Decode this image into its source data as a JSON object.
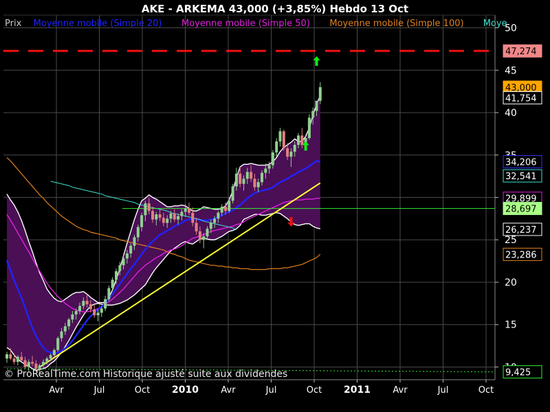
{
  "header": {
    "title": "AKE - ARKEMA    43,000 (+3,85%)    Hebdo  13 Oct"
  },
  "legend": [
    {
      "label": "Prix",
      "color": "#c8c8c8"
    },
    {
      "label": "Moyenne mobile (Simple 20)",
      "color": "#2222ff"
    },
    {
      "label": "Moyenne mobile (Simple 50)",
      "color": "#e020e0"
    },
    {
      "label": "Moyenne mobile (Simple 100)",
      "color": "#e08020"
    },
    {
      "label": "Moye",
      "color": "#40e0d0"
    }
  ],
  "copyright": "© ProRealTime.com Historique ajusté suite aux dividendes",
  "colors": {
    "background": "#000000",
    "band_fill": "#4a0f55",
    "band_edge": "#ffffff",
    "grid": "#4a4a4a",
    "up_candle": "#90d090",
    "down_candle": "#e08080",
    "resistance": "#ee1111",
    "support_line": "#ffff33",
    "horizontal_line": "#33ee33",
    "arrow_up": "#11ee11",
    "arrow_down": "#ee1111"
  },
  "chart_data": {
    "type": "candlestick",
    "ylim": [
      8.5,
      51.5
    ],
    "yticks": [
      10,
      15,
      20,
      25,
      30,
      35,
      40,
      45,
      50
    ],
    "ytick_labels": [
      "10",
      "15",
      "20",
      "25",
      "30",
      "35",
      "40",
      "45",
      "50"
    ],
    "x_tick_labels": [
      {
        "label": "Avr",
        "year": false
      },
      {
        "label": "Jul",
        "year": false
      },
      {
        "label": "Oct",
        "year": false
      },
      {
        "label": "2010",
        "year": true
      },
      {
        "label": "Avr",
        "year": false
      },
      {
        "label": "Jul",
        "year": false
      },
      {
        "label": "Oct",
        "year": false
      },
      {
        "label": "2011",
        "year": true
      },
      {
        "label": "Avr",
        "year": false
      },
      {
        "label": "Jul",
        "year": false
      },
      {
        "label": "Oct",
        "year": false
      }
    ],
    "price_ohlc": [
      [
        11.0,
        11.8,
        10.5,
        11.5
      ],
      [
        11.5,
        12.2,
        10.8,
        11.0
      ],
      [
        11.0,
        11.6,
        10.3,
        10.6
      ],
      [
        10.6,
        11.4,
        10.2,
        11.2
      ],
      [
        11.2,
        11.8,
        10.6,
        10.8
      ],
      [
        10.8,
        11.2,
        9.8,
        10.0
      ],
      [
        10.0,
        10.9,
        9.5,
        10.6
      ],
      [
        10.6,
        11.3,
        10.1,
        10.4
      ],
      [
        10.4,
        10.8,
        9.4,
        9.8
      ],
      [
        9.8,
        10.4,
        9.2,
        10.2
      ],
      [
        10.2,
        10.9,
        9.9,
        10.6
      ],
      [
        10.6,
        11.2,
        10.3,
        11.0
      ],
      [
        11.0,
        11.6,
        10.7,
        11.4
      ],
      [
        11.4,
        12.2,
        11.2,
        12.0
      ],
      [
        12.0,
        13.6,
        11.8,
        13.4
      ],
      [
        13.4,
        14.6,
        13.0,
        14.2
      ],
      [
        14.2,
        15.2,
        13.8,
        14.8
      ],
      [
        14.8,
        15.8,
        14.4,
        15.6
      ],
      [
        15.6,
        16.6,
        15.2,
        16.2
      ],
      [
        16.2,
        16.9,
        15.6,
        16.6
      ],
      [
        16.6,
        17.6,
        16.2,
        17.2
      ],
      [
        17.2,
        18.2,
        16.8,
        17.8
      ],
      [
        17.8,
        18.6,
        17.0,
        17.4
      ],
      [
        17.4,
        17.9,
        16.4,
        16.8
      ],
      [
        16.8,
        17.4,
        15.8,
        16.1
      ],
      [
        16.1,
        16.8,
        15.4,
        16.4
      ],
      [
        16.4,
        17.2,
        15.9,
        16.9
      ],
      [
        16.9,
        18.4,
        16.6,
        18.0
      ],
      [
        18.0,
        19.6,
        17.8,
        19.3
      ],
      [
        19.3,
        20.6,
        19.0,
        20.3
      ],
      [
        20.3,
        21.6,
        19.8,
        21.3
      ],
      [
        21.3,
        22.4,
        20.8,
        22.0
      ],
      [
        22.0,
        23.2,
        21.5,
        22.8
      ],
      [
        22.8,
        23.8,
        22.2,
        23.4
      ],
      [
        23.4,
        24.6,
        22.9,
        24.3
      ],
      [
        24.3,
        25.6,
        23.8,
        25.3
      ],
      [
        25.3,
        26.8,
        24.8,
        26.5
      ],
      [
        26.5,
        28.2,
        26.0,
        27.9
      ],
      [
        27.9,
        29.6,
        27.2,
        29.3
      ],
      [
        29.3,
        30.0,
        28.0,
        28.4
      ],
      [
        28.4,
        28.9,
        27.0,
        27.4
      ],
      [
        27.4,
        28.3,
        26.7,
        28.0
      ],
      [
        28.0,
        28.7,
        27.2,
        27.6
      ],
      [
        27.6,
        28.2,
        26.6,
        27.0
      ],
      [
        27.0,
        27.9,
        26.4,
        27.5
      ],
      [
        27.5,
        28.4,
        27.0,
        28.1
      ],
      [
        28.1,
        28.6,
        27.1,
        27.4
      ],
      [
        27.4,
        28.1,
        26.8,
        27.8
      ],
      [
        27.8,
        28.6,
        27.3,
        28.3
      ],
      [
        28.3,
        29.2,
        27.7,
        28.7
      ],
      [
        28.7,
        29.4,
        27.9,
        28.2
      ],
      [
        28.2,
        28.8,
        26.6,
        27.0
      ],
      [
        27.0,
        27.6,
        25.6,
        26.0
      ],
      [
        26.0,
        26.6,
        24.6,
        25.0
      ],
      [
        25.0,
        25.8,
        24.0,
        25.4
      ],
      [
        25.4,
        26.6,
        25.0,
        26.3
      ],
      [
        26.3,
        27.4,
        25.8,
        27.0
      ],
      [
        27.0,
        27.8,
        26.4,
        27.5
      ],
      [
        27.5,
        28.4,
        27.0,
        28.2
      ],
      [
        28.2,
        29.2,
        27.8,
        28.9
      ],
      [
        28.9,
        29.4,
        28.0,
        28.4
      ],
      [
        28.4,
        30.0,
        28.2,
        29.6
      ],
      [
        29.6,
        31.6,
        29.3,
        31.3
      ],
      [
        31.3,
        33.5,
        30.8,
        32.8
      ],
      [
        32.8,
        33.6,
        31.2,
        31.6
      ],
      [
        31.6,
        32.6,
        30.8,
        32.2
      ],
      [
        32.2,
        33.5,
        31.6,
        33.0
      ],
      [
        33.0,
        33.8,
        31.8,
        32.2
      ],
      [
        32.2,
        32.8,
        30.8,
        31.2
      ],
      [
        31.2,
        32.2,
        30.6,
        31.8
      ],
      [
        31.8,
        33.2,
        31.4,
        32.9
      ],
      [
        32.9,
        34.0,
        32.2,
        33.4
      ],
      [
        33.4,
        34.2,
        32.8,
        33.8
      ],
      [
        33.8,
        35.6,
        33.4,
        35.3
      ],
      [
        35.3,
        37.0,
        34.8,
        36.6
      ],
      [
        36.6,
        38.2,
        36.0,
        37.8
      ],
      [
        37.8,
        38.0,
        35.5,
        35.8
      ],
      [
        35.8,
        36.4,
        34.4,
        34.8
      ],
      [
        34.8,
        35.8,
        33.6,
        35.4
      ],
      [
        35.4,
        36.6,
        34.8,
        36.2
      ],
      [
        36.2,
        37.6,
        35.8,
        37.3
      ],
      [
        37.3,
        38.2,
        35.8,
        36.2
      ],
      [
        36.2,
        37.4,
        35.6,
        37.0
      ],
      [
        37.0,
        39.8,
        36.8,
        39.4
      ],
      [
        39.4,
        40.6,
        38.6,
        40.2
      ],
      [
        40.2,
        41.0,
        39.6,
        41.4
      ],
      [
        41.4,
        43.6,
        41.0,
        43.0
      ]
    ],
    "band_upper": [
      30.4,
      29.7,
      29.1,
      28.3,
      27.3,
      26.1,
      24.8,
      23.6,
      22.3,
      21.1,
      20.2,
      19.2,
      18.6,
      18.1,
      17.8,
      17.7,
      18.0,
      18.3,
      18.6,
      18.8,
      18.8,
      18.9,
      18.6,
      18.2,
      17.9,
      17.6,
      17.6,
      17.6,
      18.2,
      19.1,
      20.3,
      21.6,
      23.1,
      24.6,
      26.0,
      27.4,
      28.6,
      29.6,
      29.9,
      30.3,
      30.0,
      29.8,
      29.5,
      29.2,
      28.9,
      28.9,
      29.0,
      29.0,
      29.1,
      29.0,
      28.7,
      28.4,
      28.4,
      28.6,
      28.9,
      28.8,
      28.7,
      28.6,
      28.6,
      28.7,
      29.0,
      29.7,
      30.8,
      32.3,
      33.6,
      33.9,
      33.9,
      34.0,
      33.9,
      33.8,
      33.8,
      33.8,
      33.9,
      34.2,
      34.7,
      35.4,
      35.9,
      36.2,
      36.5,
      36.9,
      36.6,
      36.6,
      37.2,
      38.2,
      39.7,
      41.0,
      42.0
    ],
    "band_lower": [
      12.3,
      12.0,
      11.4,
      10.9,
      10.6,
      10.3,
      10.1,
      9.8,
      9.6,
      9.7,
      9.8,
      10.0,
      10.4,
      10.7,
      11.2,
      11.7,
      12.4,
      13.1,
      13.9,
      14.7,
      15.4,
      16.1,
      16.7,
      17.2,
      17.4,
      17.5,
      17.4,
      17.3,
      17.3,
      17.3,
      17.4,
      17.5,
      17.7,
      17.9,
      18.2,
      18.5,
      18.9,
      19.3,
      19.7,
      20.4,
      21.1,
      21.7,
      22.2,
      22.7,
      23.2,
      23.7,
      24.0,
      24.3,
      24.6,
      24.8,
      24.6,
      24.5,
      24.8,
      25.1,
      25.2,
      25.1,
      25.0,
      25.0,
      25.2,
      25.4,
      25.7,
      26.0,
      26.1,
      26.3,
      26.7,
      27.4,
      27.6,
      27.8,
      28.0,
      28.0,
      27.9,
      27.9,
      28.0,
      28.1,
      28.2,
      28.1,
      27.8,
      27.5,
      27.1,
      26.8,
      26.7,
      26.8,
      26.9,
      26.9,
      26.6,
      26.4,
      26.3
    ],
    "sma20": [
      22.6,
      21.4,
      20.2,
      19.2,
      18.2,
      17.0,
      15.8,
      14.6,
      13.7,
      12.9,
      12.3,
      11.9,
      11.7,
      11.6,
      11.7,
      11.9,
      12.2,
      12.6,
      13.1,
      13.7,
      14.3,
      14.9,
      15.5,
      16.0,
      16.4,
      16.8,
      17.1,
      17.5,
      18.1,
      18.6,
      19.2,
      19.8,
      20.4,
      21.0,
      21.6,
      22.1,
      22.7,
      23.3,
      23.9,
      24.4,
      24.8,
      25.2,
      25.6,
      25.8,
      26.1,
      26.3,
      26.6,
      26.8,
      27.0,
      27.3,
      27.4,
      27.5,
      27.4,
      27.3,
      27.3,
      27.3,
      27.4,
      27.5,
      27.7,
      27.9,
      28.1,
      28.3,
      28.5,
      28.8,
      29.1,
      29.5,
      29.9,
      30.2,
      30.5,
      30.7,
      30.8,
      30.9,
      31.0,
      31.2,
      31.5,
      31.8,
      32.0,
      32.2,
      32.5,
      32.7,
      33.0,
      33.2,
      33.4,
      33.7,
      34.0,
      34.3,
      34.2
    ],
    "sma50": [
      28.0,
      27.3,
      26.6,
      25.8,
      25.1,
      24.3,
      23.6,
      22.8,
      22.0,
      21.3,
      20.6,
      19.9,
      19.3,
      18.8,
      18.3,
      17.9,
      17.5,
      17.2,
      16.9,
      16.7,
      16.6,
      16.5,
      16.5,
      16.6,
      16.7,
      16.9,
      17.1,
      17.4,
      17.7,
      18.0,
      18.4,
      18.8,
      19.2,
      19.7,
      20.2,
      20.7,
      21.2,
      21.6,
      22.0,
      22.3,
      22.6,
      22.9,
      23.1,
      23.4,
      23.6,
      23.8,
      23.9,
      24.1,
      24.3,
      24.6,
      24.9,
      25.2,
      25.3,
      25.5,
      25.6,
      25.8,
      26.0,
      26.1,
      26.2,
      26.3,
      26.4,
      26.5,
      26.6,
      26.8,
      26.9,
      27.1,
      27.4,
      27.6,
      27.8,
      28.0,
      28.2,
      28.4,
      28.6,
      28.8,
      29.0,
      29.2,
      29.4,
      29.5,
      29.6,
      29.7,
      29.7,
      29.7,
      29.8,
      29.8,
      29.8,
      29.9,
      29.9
    ],
    "sma100": [
      34.7,
      34.3,
      33.8,
      33.3,
      32.8,
      32.3,
      31.8,
      31.3,
      30.8,
      30.3,
      29.9,
      29.4,
      29.0,
      28.6,
      28.2,
      27.8,
      27.5,
      27.2,
      26.9,
      26.6,
      26.4,
      26.2,
      26.1,
      25.9,
      25.8,
      25.7,
      25.6,
      25.5,
      25.4,
      25.3,
      25.2,
      25.0,
      24.9,
      24.8,
      24.7,
      24.6,
      24.5,
      24.4,
      24.3,
      24.2,
      24.1,
      24.0,
      23.9,
      23.8,
      23.6,
      23.4,
      23.3,
      23.1,
      23.0,
      22.8,
      22.6,
      22.5,
      22.4,
      22.3,
      22.2,
      22.1,
      22.0,
      22.0,
      21.9,
      21.9,
      21.8,
      21.8,
      21.7,
      21.7,
      21.6,
      21.6,
      21.6,
      21.5,
      21.5,
      21.5,
      21.5,
      21.5,
      21.6,
      21.6,
      21.6,
      21.6,
      21.7,
      21.7,
      21.8,
      21.9,
      22.0,
      22.1,
      22.3,
      22.5,
      22.7,
      22.9,
      23.3
    ],
    "turquoise_line": [
      31.9,
      31.8,
      31.7,
      31.6,
      31.5,
      31.4,
      31.2,
      31.1,
      31.0,
      30.9,
      30.8,
      30.7,
      30.6,
      30.5,
      30.4,
      30.2,
      30.1,
      30.0,
      29.9,
      29.8,
      29.7,
      29.6,
      29.5,
      29.4,
      29.2,
      29.1,
      29.0,
      28.9,
      28.8,
      28.7,
      28.6,
      28.5,
      28.4,
      28.2,
      28.1,
      28.0,
      27.9,
      27.8,
      27.7,
      27.6,
      27.5,
      27.4,
      27.2,
      27.1,
      27.0,
      26.9,
      26.8,
      26.7,
      26.6,
      26.5,
      26.4,
      26.2
    ],
    "support_line": {
      "start": [
        0,
        10.0
      ],
      "end": [
        86,
        31.7
      ]
    },
    "resistance_level": 47.274,
    "horizontal_level": 28.697,
    "arrows_up": [
      [
        82,
        36.0
      ],
      [
        85,
        46.0
      ]
    ],
    "arrows_down": [
      [
        78,
        27.2
      ]
    ],
    "price_tags": [
      {
        "label": "47,274",
        "value": 47.274,
        "bg": "#f08888",
        "fg": "#000000",
        "border": "#f08888"
      },
      {
        "label": "43,000",
        "value": 43.0,
        "bg": "#ffa500",
        "fg": "#000000",
        "border": "#ffa500"
      },
      {
        "label": "41,754",
        "value": 41.754,
        "bg": "#000000",
        "fg": "#ffffff",
        "border": "#ffffff"
      },
      {
        "label": "34,206",
        "value": 34.206,
        "bg": "#000000",
        "fg": "#ffffff",
        "border": "#3333ff"
      },
      {
        "label": "32,541",
        "value": 32.541,
        "bg": "#000000",
        "fg": "#ffffff",
        "border": "#40e0d0"
      },
      {
        "label": "29,899",
        "value": 29.899,
        "bg": "#000000",
        "fg": "#ffffff",
        "border": "#e020e0"
      },
      {
        "label": "28,697",
        "value": 28.697,
        "bg": "#aaff88",
        "fg": "#000000",
        "border": "#aaff88"
      },
      {
        "label": "26,237",
        "value": 26.237,
        "bg": "#000000",
        "fg": "#ffffff",
        "border": "#ffffff"
      },
      {
        "label": "23,286",
        "value": 23.286,
        "bg": "#000000",
        "fg": "#ffffff",
        "border": "#e08020"
      },
      {
        "label": "9,425",
        "value": 9.425,
        "bg": "#000000",
        "fg": "#ffffff",
        "border": "#33ee33"
      }
    ]
  }
}
